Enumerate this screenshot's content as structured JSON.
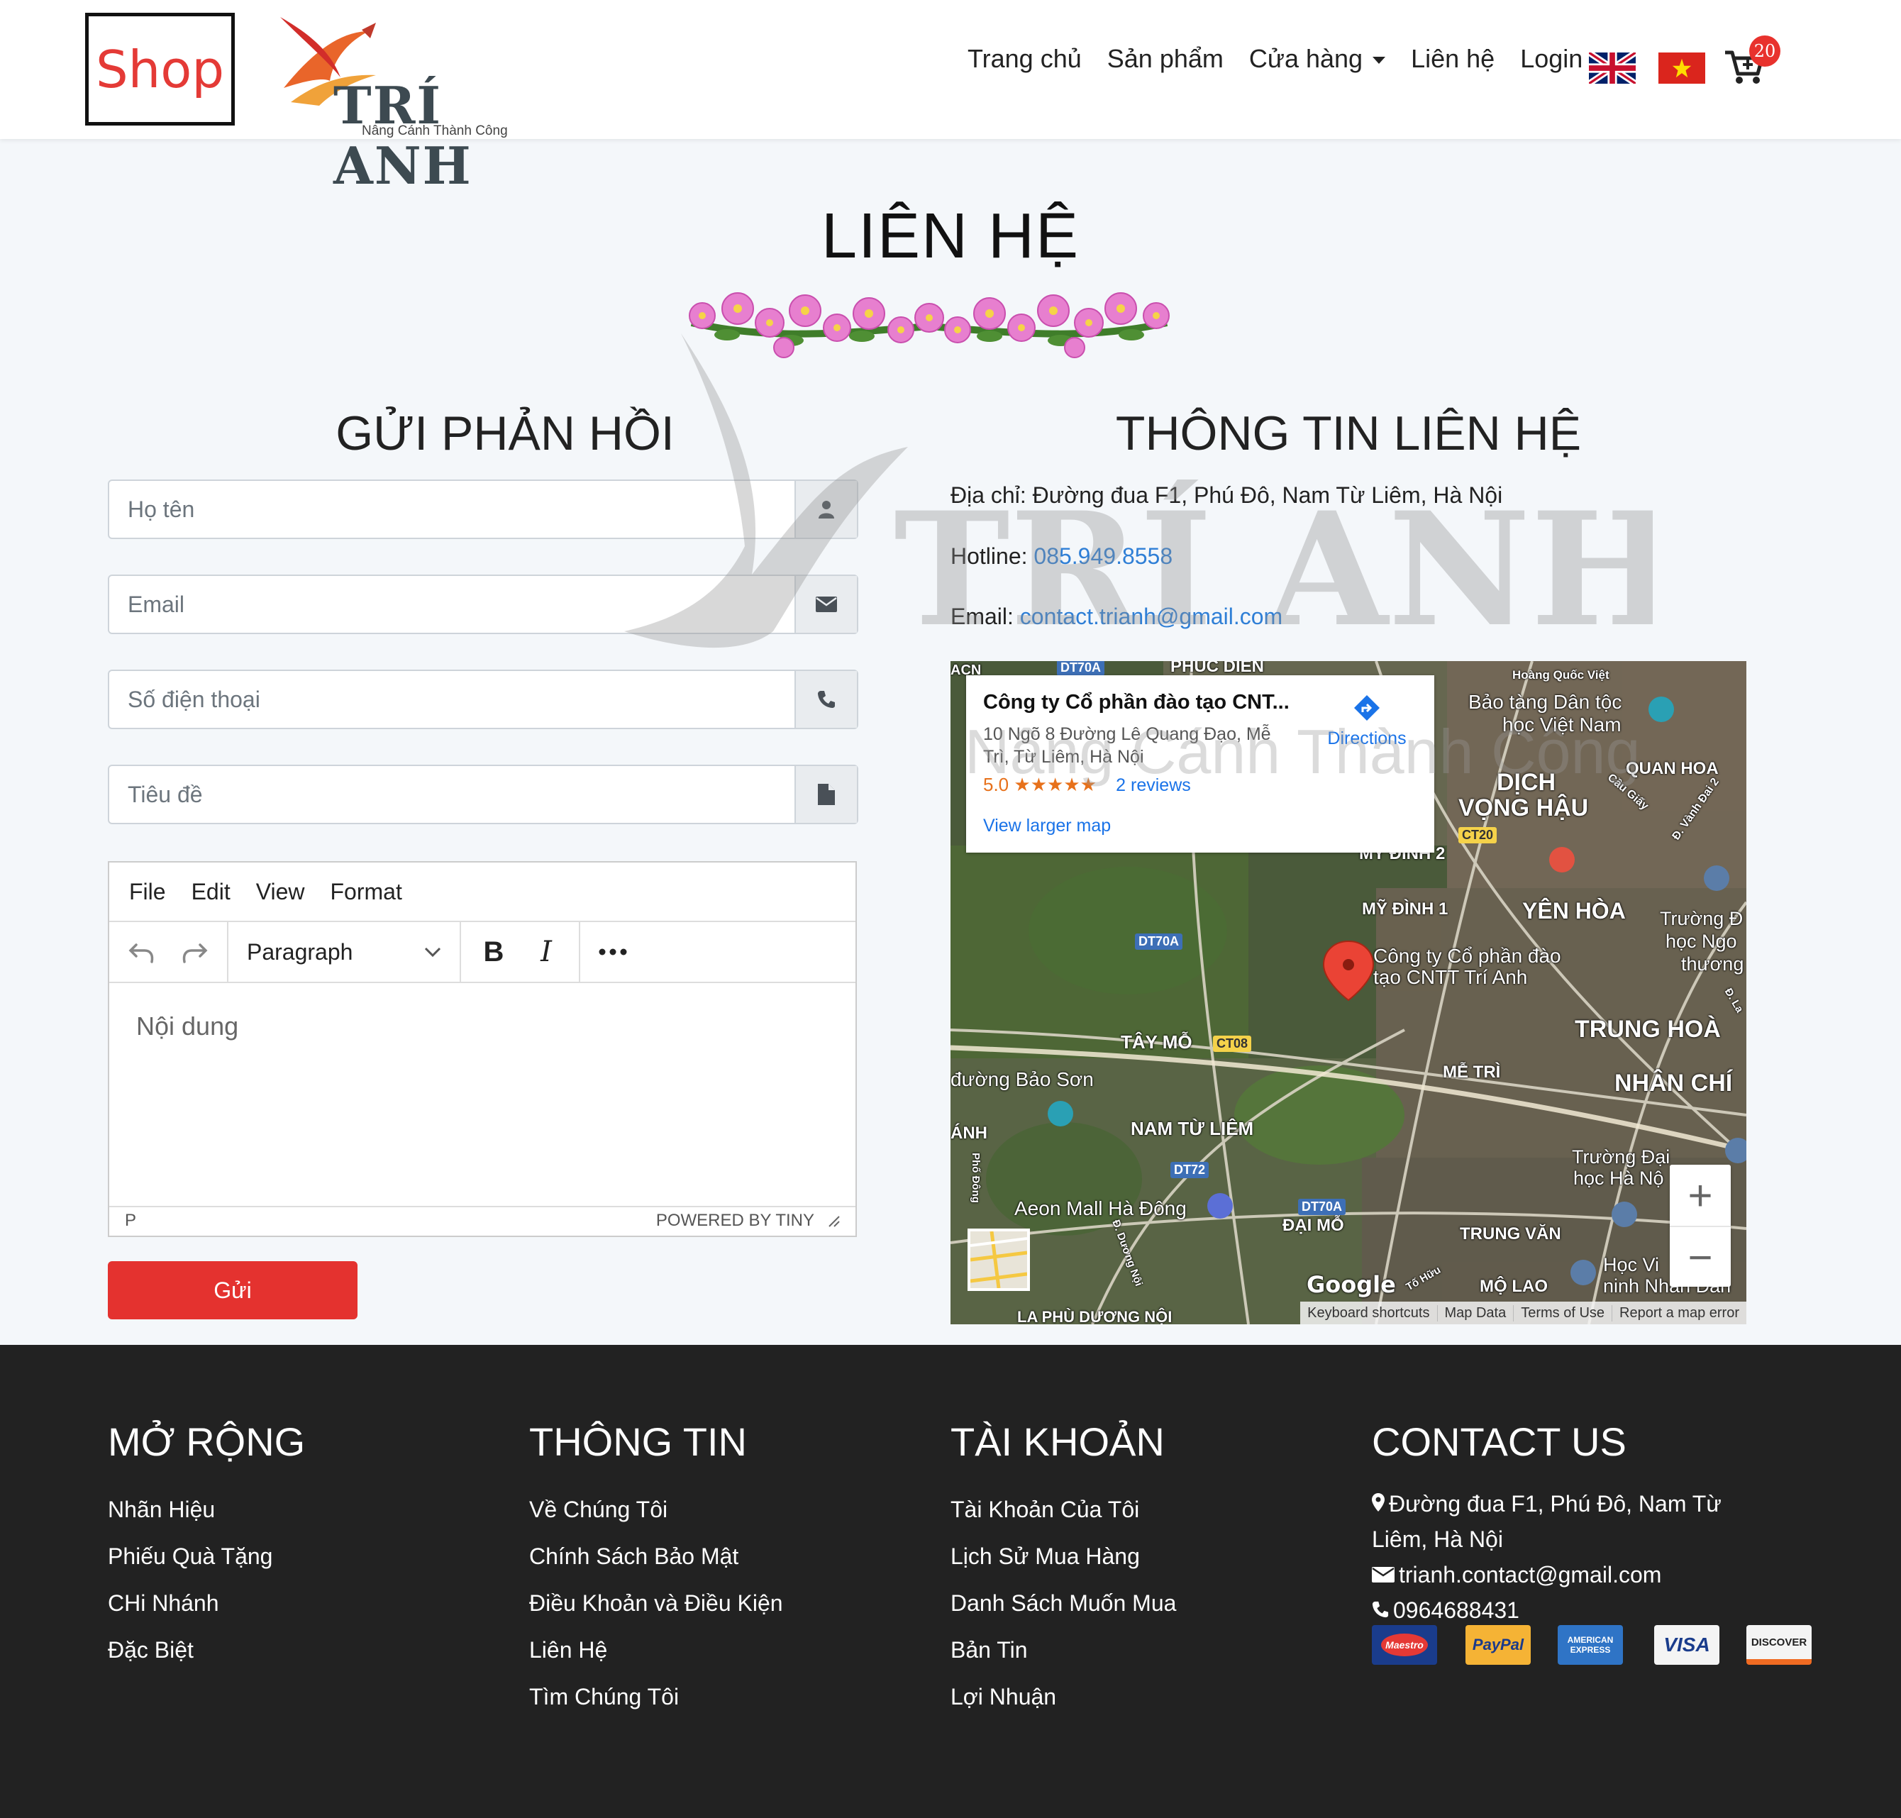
{
  "header": {
    "shop_label": "Shop",
    "logo_text": "TRÍ ANH",
    "logo_slogan": "Nâng Cánh Thành Công",
    "nav": [
      "Trang chủ",
      "Sản phẩm",
      "Cửa hàng",
      "Liên hệ",
      "Login"
    ],
    "cart_count": "20",
    "flags": [
      "uk-flag",
      "vietnam-flag"
    ]
  },
  "page": {
    "title": "LIÊN HỆ"
  },
  "form": {
    "title": "GỬI PHẢN HỒI",
    "name_placeholder": "Họ tên",
    "email_placeholder": "Email",
    "phone_placeholder": "Số điện thoại",
    "subject_placeholder": "Tiêu đề",
    "editor": {
      "menu": [
        "File",
        "Edit",
        "View",
        "Format"
      ],
      "block_format": "Paragraph",
      "content_placeholder": "Nội dung",
      "status_path": "P",
      "powered_by": "POWERED BY TINY"
    },
    "submit_label": "Gửi"
  },
  "contact": {
    "title": "THÔNG TIN LIÊN HỆ",
    "address_label": "Địa chỉ:",
    "address": "Đường đua F1, Phú Đô, Nam Từ Liêm, Hà Nội",
    "hotline_label": "Hotline:",
    "hotline": "085.949.8558",
    "email_label": "Email:",
    "email": "contact.trianh@gmail.com"
  },
  "map": {
    "card_name": "Công ty Cổ phần đào tạo CNT...",
    "card_address": "10 Ngõ 8 Đường Lê Quang Đạo, Mễ Trì, Từ Liêm, Hà Nội",
    "rating": "5.0",
    "stars": "★★★★★",
    "reviews": "2 reviews",
    "larger_map": "View larger map",
    "directions": "Directions",
    "pin_label_1": "Công ty Cổ phần đào",
    "pin_label_2": "tạo CNTT Trí Anh",
    "zoom_in": "+",
    "zoom_out": "−",
    "attribution": [
      "Keyboard shortcuts",
      "Map Data",
      "Terms of Use",
      "Report a map error"
    ],
    "google": "Google",
    "labels": {
      "phuc_dien": "PHÚC DIỄN",
      "hoang_quoc_viet": "Hoàng Quốc Việt",
      "bao_tang_1": "Bảo tàng Dân tộc",
      "bao_tang_2": "học Việt Nam",
      "dich_vong_1": "DỊCH",
      "dich_vong_2": "VỌNG HẬU",
      "quan_hoa": "QUAN HOA",
      "cau_giay": "Cầu Giấy",
      "vanh_dai": "Đ. Vành Đai 2",
      "my_dinh_2": "MỸ ĐÌNH 2",
      "my_dinh_1": "MỸ ĐÌNH 1",
      "yen_hoa": "YÊN HÒA",
      "truong_1": "Trường Đ",
      "truong_2": "học Ngo",
      "truong_3": "thương",
      "trung_hoa": "TRUNG HOÀ",
      "tay_mo": "TÂY MỖ",
      "me_tri": "MỄ TRÌ",
      "nhan_chinh": "NHÂN CHÍ",
      "bao_son": "đường Bảo Sơn",
      "anh": "ÁNH",
      "nam_tu_liem": "NAM TỪ LIÊM",
      "truong_dai_1": "Trường Đại",
      "truong_dai_2": "học Hà Nộ",
      "aeon": "Aeon Mall Hà Đông",
      "dai_mo": "ĐẠI MỖ",
      "trung_van": "TRUNG VĂN",
      "hoc_vien_1": "Học Vi",
      "hoc_vien_2": "ninh Nhân Dân",
      "mo_lao": "MỘ LAO",
      "la_phu": "LA PHÙ DƯƠNG NỘI",
      "to_huu": "Tố Hữu",
      "phu_dong": "Phố Đông",
      "duong_noi": "Đ. Dương Nội",
      "acn": "ACN",
      "d_lang": "Đ. La"
    },
    "road_tags": [
      "DT70A",
      "CT20",
      "DT70A",
      "CT08",
      "DT72",
      "DT70A"
    ]
  },
  "footer": {
    "columns": [
      {
        "title": "MỞ RỘNG",
        "links": [
          "Nhãn Hiệu",
          "Phiếu Quà Tặng",
          "CHi Nhánh",
          "Đặc Biệt"
        ]
      },
      {
        "title": "THÔNG TIN",
        "links": [
          "Về Chúng Tôi",
          "Chính Sách Bảo Mật",
          "Điều Khoản và Điều Kiện",
          "Liên Hệ",
          "Tìm Chúng Tôi"
        ]
      },
      {
        "title": "TÀI KHOẢN",
        "links": [
          "Tài Khoản Của Tôi",
          "Lịch Sử Mua Hàng",
          "Danh Sách Muốn Mua",
          "Bản Tin",
          "Lợi Nhuận"
        ]
      }
    ],
    "contact_title": "CONTACT US",
    "contact_address_1": "Đường đua F1, Phú Đô, Nam Từ",
    "contact_address_2": "Liêm, Hà Nội",
    "contact_email": "trianh.contact@gmail.com",
    "contact_phone": "0964688431",
    "payments": [
      "Maestro",
      "PayPal",
      "AMERICAN EXPRESS",
      "VISA",
      "DISCOVER"
    ]
  },
  "watermark": {
    "text": "TRÍ ANH",
    "slogan": "Nâng Cánh Thành Công"
  },
  "colors": {
    "accent_red": "#e4322f",
    "link_blue": "#2f7fd6",
    "footer_bg": "#222222",
    "page_bg": "#f4f7fa"
  }
}
